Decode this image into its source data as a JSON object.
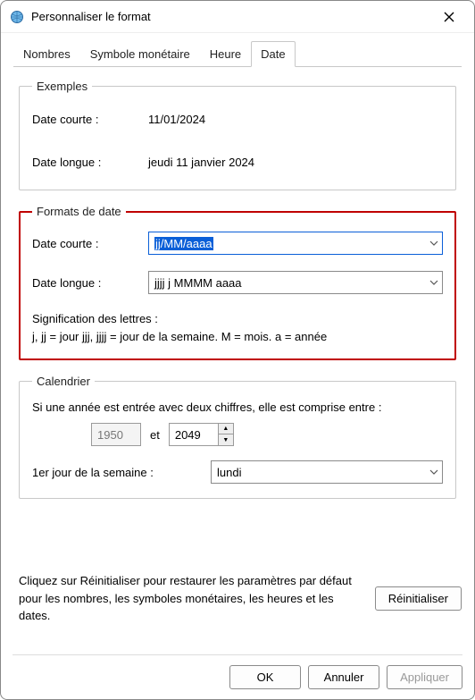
{
  "window": {
    "title": "Personnaliser le format"
  },
  "tabs": {
    "numbers": "Nombres",
    "currency": "Symbole monétaire",
    "time": "Heure",
    "date": "Date"
  },
  "examples": {
    "legend": "Exemples",
    "short_label": "Date courte :",
    "short_value": "11/01/2024",
    "long_label": "Date longue :",
    "long_value": "jeudi 11 janvier 2024"
  },
  "formats": {
    "legend": "Formats de date",
    "short_label": "Date courte :",
    "short_value": "jj/MM/aaaa",
    "long_label": "Date longue :",
    "long_value": "jjjj j MMMM aaaa",
    "note_title": "Signification des lettres :",
    "note_body": "j, jj = jour  jjj, jjjj = jour de la semaine. M = mois. a = année"
  },
  "calendar": {
    "legend": "Calendrier",
    "two_digit_text": "Si une année est entrée avec deux chiffres, elle est comprise entre :",
    "year_from": "1950",
    "and": "et",
    "year_to": "2049",
    "first_day_label": "1er jour de la semaine :",
    "first_day_value": "lundi"
  },
  "reset": {
    "text": "Cliquez sur Réinitialiser pour restaurer les paramètres par défaut pour les nombres, les symboles monétaires, les heures et les dates.",
    "button": "Réinitialiser"
  },
  "buttons": {
    "ok": "OK",
    "cancel": "Annuler",
    "apply": "Appliquer"
  }
}
